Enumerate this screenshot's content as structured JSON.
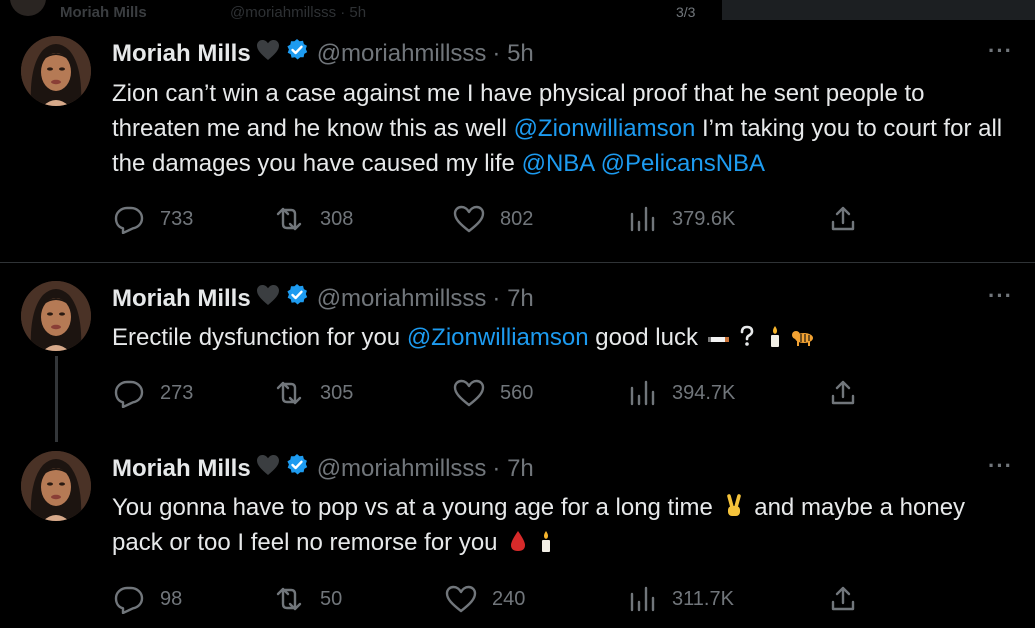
{
  "topbar": {
    "faded_name": "Moriah Mills",
    "faded_handle": "@moriahmillsss · 5h",
    "page_indicator": "3/3"
  },
  "colors": {
    "background": "#000000",
    "text": "#e7e9ea",
    "secondary": "#71767b",
    "mention": "#1d9bf0",
    "verified": "#1d9bf0",
    "divider": "#2f3336"
  },
  "tweets": [
    {
      "name": "Moriah Mills",
      "handle": "@moriahmillsss",
      "time": "· 5h",
      "more": "···",
      "text_parts": {
        "p1": "Zion can’t win a case against me I have physical proof that he sent people to threaten me and he know this as well ",
        "m1": "@Zionwilliamson",
        "p2": " I’m taking you to court for all the damages you have caused my life ",
        "m2": "@NBA",
        "p3": " ",
        "m3": "@PelicansNBA"
      },
      "stats": {
        "replies": "733",
        "reposts": "308",
        "likes": "802",
        "views": "379.6K"
      }
    },
    {
      "name": "Moriah Mills",
      "handle": "@moriahmillsss",
      "time": "· 7h",
      "more": "···",
      "text_parts": {
        "p1": "Erectile dysfunction for you ",
        "m1": "@Zionwilliamson",
        "p2": " good luck "
      },
      "emojis": [
        "cigarette",
        "question-mark",
        "candle",
        "tiger"
      ],
      "stats": {
        "replies": "273",
        "reposts": "305",
        "likes": "560",
        "views": "394.7K"
      }
    },
    {
      "name": "Moriah Mills",
      "handle": "@moriahmillsss",
      "time": "· 7h",
      "more": "···",
      "text_parts": {
        "p1": "You gonna have to pop vs at a young age for a long time ",
        "p2": " and maybe a honey pack or too I feel no remorse for you "
      },
      "emojis": [
        "victory-hand",
        "blood-drop",
        "candle"
      ],
      "stats": {
        "replies": "98",
        "reposts": "50",
        "likes": "240",
        "views": "311.7K"
      }
    }
  ]
}
